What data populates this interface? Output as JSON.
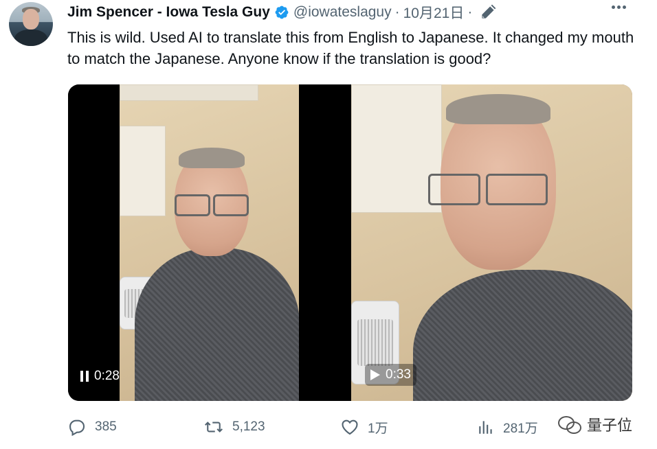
{
  "tweet": {
    "author_name": "Jim Spencer - Iowa Tesla Guy",
    "handle": "@iowateslaguy",
    "separator": "·",
    "date": "10月21日",
    "date_separator": "·",
    "text": "This is wild. Used AI to translate this from English to Japanese. It changed my mouth to match the Japanese. Anyone know if the translation is good?"
  },
  "videos": [
    {
      "state": "playing",
      "time": "0:28",
      "icon": "pause-icon"
    },
    {
      "state": "paused",
      "time": "0:33",
      "icon": "play-icon"
    }
  ],
  "actions": {
    "replies": "385",
    "reposts": "5,123",
    "likes": "1万",
    "views": "281万"
  },
  "watermark": {
    "text": "量子位"
  },
  "colors": {
    "verified": "#1d9bf0",
    "secondary_text": "#536471",
    "primary_text": "#0f1419"
  }
}
